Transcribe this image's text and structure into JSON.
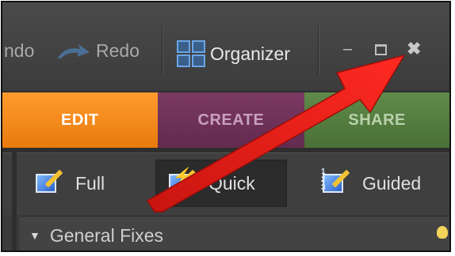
{
  "toolbar": {
    "undo_label": "ndo",
    "redo_label": "Redo",
    "organizer_label": "Organizer",
    "minimize_glyph": "–",
    "close_glyph": "✖"
  },
  "tabs": [
    {
      "label": "EDIT",
      "active": true
    },
    {
      "label": "CREATE",
      "active": false
    },
    {
      "label": "SHARE",
      "active": false
    }
  ],
  "modes": [
    {
      "label": "Full",
      "icon": "full-edit-icon"
    },
    {
      "label": "Quick",
      "icon": "quick-edit-icon",
      "selected": true
    },
    {
      "label": "Guided",
      "icon": "guided-edit-icon"
    }
  ],
  "panel": {
    "section_title": "General Fixes"
  },
  "colors": {
    "edit_tab": "#f08a1c",
    "create_tab": "#6e315a",
    "share_tab": "#557d41",
    "annotation_arrow": "#e8201a"
  }
}
